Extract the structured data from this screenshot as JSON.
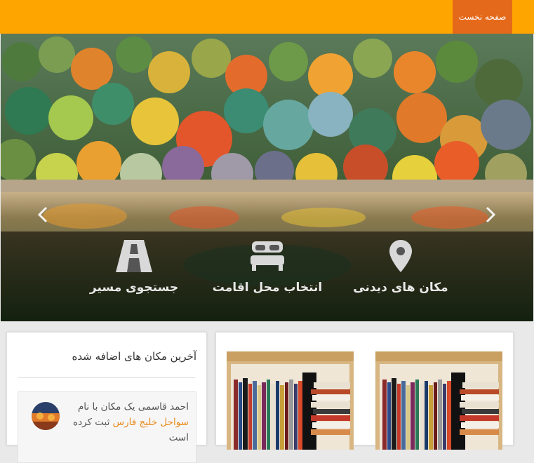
{
  "nav": {
    "home_label": "صفحه نخست"
  },
  "hero": {
    "image": "autumn-forest-lake-photo",
    "prev_icon": "chevron-left-icon",
    "next_icon": "chevron-right-icon"
  },
  "features": [
    {
      "icon": "map-pin-icon",
      "label": "مکان های دیدنی"
    },
    {
      "icon": "bed-icon",
      "label": "انتخاب محل اقامت"
    },
    {
      "icon": "road-icon",
      "label": "جستجوی مسیر"
    }
  ],
  "latest": {
    "title": "آخرین مکان های اضافه شده",
    "activity": {
      "prefix": "احمد قاسمی یک مکان با نام",
      "place": "سواحل خلیج فارس",
      "suffix": "ثبت کرده است"
    }
  },
  "cards": [
    {
      "image": "books-on-shelf-photo"
    },
    {
      "image": "books-on-shelf-photo"
    }
  ],
  "colors": {
    "topbar": "#ffa500",
    "nav_active": "#e5691a",
    "link": "#e98a1a"
  }
}
